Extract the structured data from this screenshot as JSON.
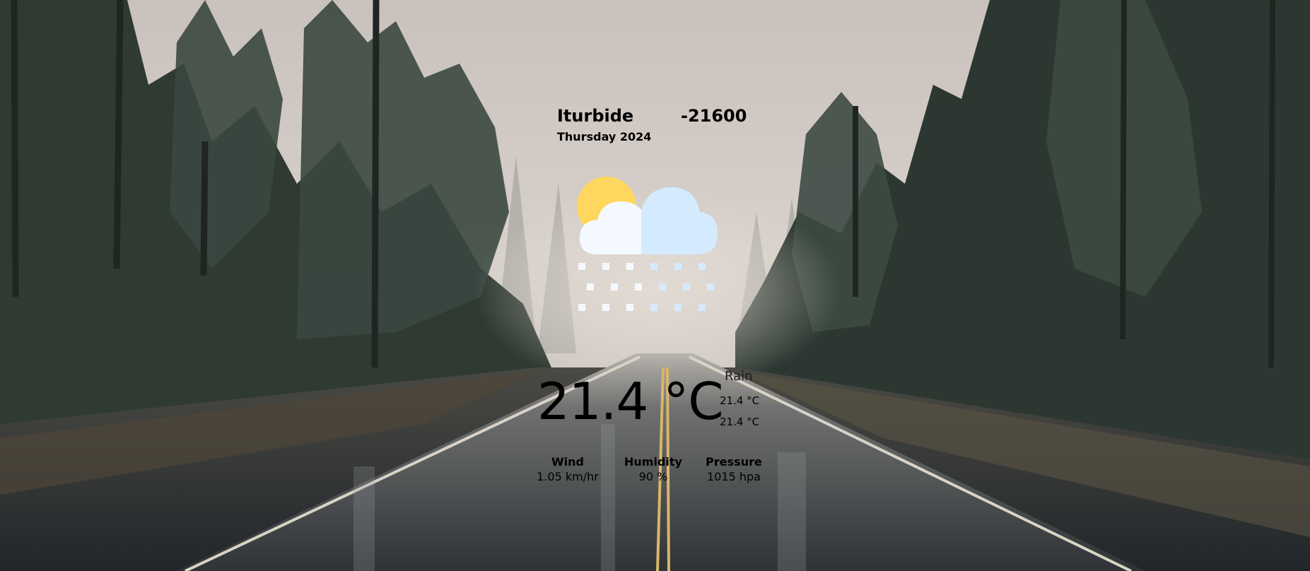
{
  "weather": {
    "city": "Iturbide",
    "timezone_offset": "-21600",
    "date": "Thursday 2024",
    "condition_icon": "sun-cloud-snow-icon",
    "temperature": "21.4 °C",
    "condition": "Rain",
    "temp_max": "21.4 °C",
    "temp_min": "21.4 °C",
    "stats": {
      "wind_label": "Wind",
      "wind_value": "1.05 km/hr",
      "humidity_label": "Humidity",
      "humidity_value": "90 %",
      "pressure_label": "Pressure",
      "pressure_value": "1015 hpa"
    }
  },
  "colors": {
    "sun": "#FFD75E",
    "cloud_light": "#F4F9FF",
    "cloud_shade": "#D4EBFF",
    "text": "#000000"
  }
}
